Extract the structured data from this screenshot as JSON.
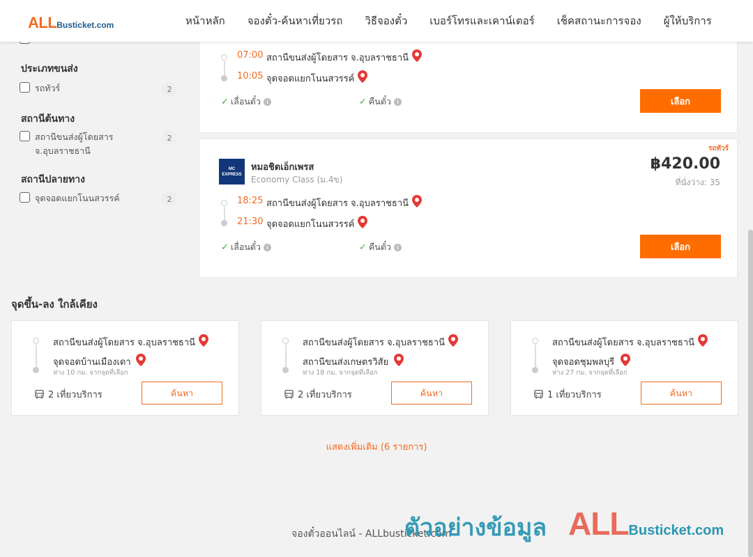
{
  "header": {
    "logo_all": "ALL",
    "logo_site": "Busticket.com",
    "nav": [
      "หน้าหลัก",
      "จองตั๋ว-ค้นหาเที่ยวรถ",
      "วิธีจองตั๋ว",
      "เบอร์โทรและเคาน์เตอร์",
      "เช็คสถานะการจอง",
      "ผู้ให้บริการ"
    ]
  },
  "sidebar": {
    "vehicle_type": {
      "title": "ประเภทขนส่ง",
      "items": [
        {
          "label": "รถทัวร์",
          "count": "2"
        }
      ]
    },
    "origin": {
      "title": "สถานีต้นทาง",
      "items": [
        {
          "label": "สถานีขนส่งผู้โดยสาร จ.อุบลราชธานี",
          "count": "2"
        }
      ]
    },
    "destination": {
      "title": "สถานีปลายทาง",
      "items": [
        {
          "label": "จุดจอดแยกโนนสวรรค์",
          "count": "2"
        }
      ]
    }
  },
  "trips": [
    {
      "depart_time": "07:00",
      "depart_station": "สถานีขนส่งผู้โดยสาร จ.อุบลราชธานี",
      "arrive_time": "10:05",
      "arrive_station": "จุดจอดแยกโนนสวรรค์",
      "feature_postpone": "เลื่อนตั๋ว",
      "feature_refund": "คืนตั๋ว",
      "select_label": "เลือก"
    },
    {
      "vehicle_type": "รถทัวร์",
      "operator_logo": "MC EXPRESS",
      "operator": "หมอชิตเอ็กเพรส",
      "class": "Economy Class (ม.4ข)",
      "price": "฿420.00",
      "seats": "ที่นั่งว่าง: 35",
      "depart_time": "18:25",
      "depart_station": "สถานีขนส่งผู้โดยสาร จ.อุบลราชธานี",
      "arrive_time": "21:30",
      "arrive_station": "จุดจอดแยกโนนสวรรค์",
      "feature_postpone": "เลื่อนตั๋ว",
      "feature_refund": "คืนตั๋ว",
      "select_label": "เลือก"
    }
  ],
  "nearby": {
    "title": "จุดขึ้น-ลง ใกล้เคียง",
    "cards": [
      {
        "from": "สถานีขนส่งผู้โดยสาร จ.อุบลราชธานี",
        "to": "จุดจอดบ้านเมืองเดา",
        "distance": "ห่าง 10 กม. จากจุดที่เลือก",
        "trips": "2 เที่ยวบริการ",
        "button": "ค้นหา"
      },
      {
        "from": "สถานีขนส่งผู้โดยสาร จ.อุบลราชธานี",
        "to": "สถานีขนส่งเกษตรวิสัย",
        "distance": "ห่าง 18 กม. จากจุดที่เลือก",
        "trips": "2 เที่ยวบริการ",
        "button": "ค้นหา"
      },
      {
        "from": "สถานีขนส่งผู้โดยสาร จ.อุบลราชธานี",
        "to": "จุดจอดชุมพลบุรี",
        "distance": "ห่าง 27 กม. จากจุดที่เลือก",
        "trips": "1 เที่ยวบริการ",
        "button": "ค้นหา"
      }
    ],
    "show_more": "แสดงเพิ่มเติม (6 รายการ)"
  },
  "footer": {
    "text": "จองตั๋วออนไลน์ - ALLbusticket.com",
    "watermark_text": "ตัวอย่างข้อมูล",
    "watermark_all": "ALL",
    "watermark_site": "Busticket.com"
  },
  "colors": {
    "accent": "#ff6d00",
    "brand_blue": "#1e5a8c",
    "pin_red": "#e53935",
    "check_green": "#3cab3c"
  }
}
